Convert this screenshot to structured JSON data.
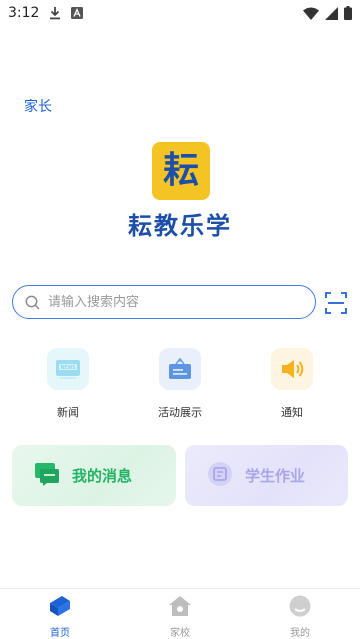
{
  "status_bar": {
    "time": "3:12"
  },
  "role_label": "家长",
  "logo": {
    "char": "耘",
    "bg_color": "#f4c425",
    "fg_color": "#1d4fa8"
  },
  "app_title": "耘教乐学",
  "search": {
    "placeholder": "请输入搜索内容",
    "value": ""
  },
  "quick_actions": [
    {
      "label": "新闻",
      "icon": "news-icon",
      "bg": "#e6f7fb"
    },
    {
      "label": "活动展示",
      "icon": "activity-board-icon",
      "bg": "#e9f0fb"
    },
    {
      "label": "通知",
      "icon": "speaker-icon",
      "bg": "#fdf5e2"
    }
  ],
  "cards": {
    "messages": {
      "label": "我的消息",
      "icon": "chat-icon",
      "color": "#23b365"
    },
    "homework": {
      "label": "学生作业",
      "icon": "homework-icon",
      "color": "#a9a6e8"
    }
  },
  "bottom_nav": [
    {
      "label": "首页",
      "icon": "home-book-icon",
      "active": true
    },
    {
      "label": "家校",
      "icon": "school-house-icon",
      "active": false
    },
    {
      "label": "我的",
      "icon": "profile-icon",
      "active": false
    }
  ],
  "colors": {
    "accent": "#1e63d6",
    "inactive": "#9b9b9b"
  }
}
